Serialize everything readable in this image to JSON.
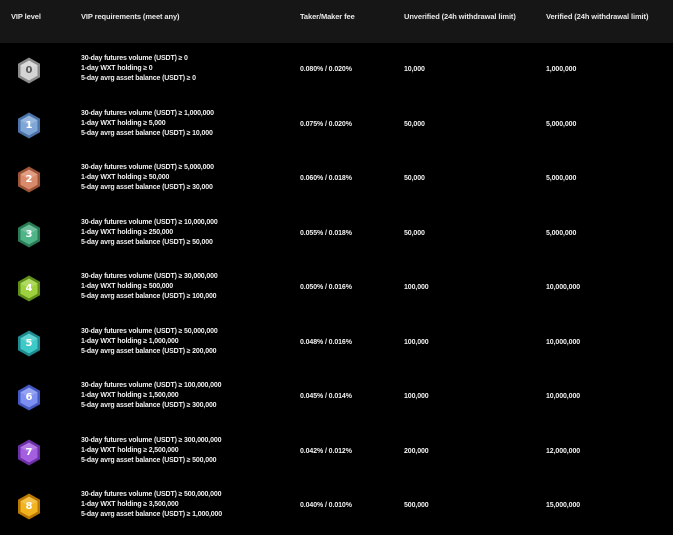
{
  "headers": {
    "vip_level": "VIP level",
    "requirements": "VIP requirements (meet any)",
    "fee": "Taker/Maker fee",
    "unverified": "Unverified (24h withdrawal limit)",
    "verified": "Verified (24h withdrawal limit)"
  },
  "rows": [
    {
      "level": "0",
      "badge_color": "#d4d4d4",
      "badge_dark": "#8c8c8c",
      "badge_text": "#5a5a5a",
      "req1": "30-day futures volume (USDT) ≥ 0",
      "req2": "1-day WXT holding ≥ 0",
      "req3": "5-day avrg asset balance (USDT) ≥ 0",
      "fee": "0.080% / 0.020%",
      "unverified": "10,000",
      "verified": "1,000,000"
    },
    {
      "level": "1",
      "badge_color": "#7fa6d6",
      "badge_dark": "#4b73a8",
      "badge_text": "#ffffff",
      "req1": "30-day futures volume (USDT) ≥ 1,000,000",
      "req2": "1-day WXT holding ≥ 5,000",
      "req3": "5-day avrg asset balance (USDT) ≥ 10,000",
      "fee": "0.075% / 0.020%",
      "unverified": "50,000",
      "verified": "5,000,000"
    },
    {
      "level": "2",
      "badge_color": "#d98a6a",
      "badge_dark": "#9e5537",
      "badge_text": "#ffffff",
      "req1": "30-day futures volume (USDT) ≥ 5,000,000",
      "req2": "1-day WXT holding ≥ 50,000",
      "req3": "5-day avrg asset balance (USDT) ≥ 30,000",
      "fee": "0.060% / 0.018%",
      "unverified": "50,000",
      "verified": "5,000,000"
    },
    {
      "level": "3",
      "badge_color": "#4fb487",
      "badge_dark": "#2a7a55",
      "badge_text": "#ffffff",
      "req1": "30-day futures volume (USDT) ≥ 10,000,000",
      "req2": "1-day WXT holding ≥ 250,000",
      "req3": "5-day avrg asset balance (USDT) ≥ 50,000",
      "fee": "0.055% / 0.018%",
      "unverified": "50,000",
      "verified": "5,000,000"
    },
    {
      "level": "4",
      "badge_color": "#9ed13d",
      "badge_dark": "#5f8f1a",
      "badge_text": "#ffffff",
      "req1": "30-day futures volume (USDT) ≥ 30,000,000",
      "req2": "1-day WXT holding ≥ 500,000",
      "req3": "5-day avrg asset balance (USDT) ≥ 100,000",
      "fee": "0.050% / 0.016%",
      "unverified": "100,000",
      "verified": "10,000,000"
    },
    {
      "level": "5",
      "badge_color": "#3ec9c9",
      "badge_dark": "#1f8a8f",
      "badge_text": "#ffffff",
      "req1": "30-day futures volume (USDT) ≥ 50,000,000",
      "req2": "1-day WXT holding ≥ 1,000,000",
      "req3": "5-day avrg asset balance (USDT) ≥ 200,000",
      "fee": "0.048% / 0.016%",
      "unverified": "100,000",
      "verified": "10,000,000"
    },
    {
      "level": "6",
      "badge_color": "#7d8ff0",
      "badge_dark": "#4558c2",
      "badge_text": "#ffffff",
      "req1": "30-day futures volume (USDT) ≥ 100,000,000",
      "req2": "1-day WXT holding ≥ 1,500,000",
      "req3": "5-day avrg asset balance (USDT) ≥ 300,000",
      "fee": "0.045% / 0.014%",
      "unverified": "100,000",
      "verified": "10,000,000"
    },
    {
      "level": "7",
      "badge_color": "#a45ee0",
      "badge_dark": "#6c2fa6",
      "badge_text": "#ffffff",
      "req1": "30-day futures volume (USDT) ≥ 300,000,000",
      "req2": "1-day WXT holding ≥ 2,500,000",
      "req3": "5-day avrg asset balance (USDT) ≥ 500,000",
      "fee": "0.042% / 0.012%",
      "unverified": "200,000",
      "verified": "12,000,000"
    },
    {
      "level": "8",
      "badge_color": "#f2b320",
      "badge_dark": "#b87800",
      "badge_text": "#ffffff",
      "req1": "30-day futures volume (USDT) ≥ 500,000,000",
      "req2": "1-day WXT holding ≥ 3,500,000",
      "req3": "5-day avrg asset balance (USDT) ≥ 1,000,000",
      "fee": "0.040% / 0.010%",
      "unverified": "500,000",
      "verified": "15,000,000"
    }
  ]
}
